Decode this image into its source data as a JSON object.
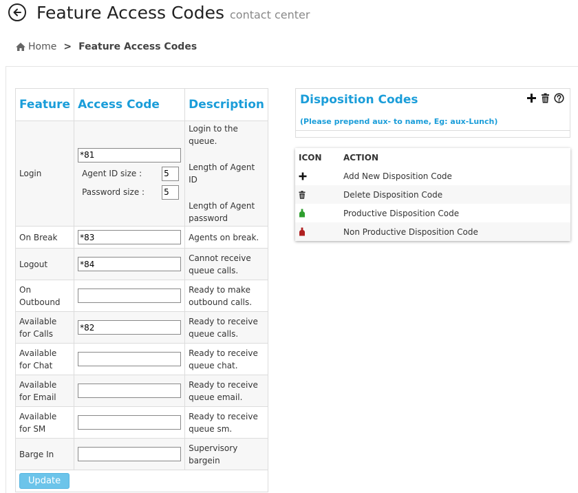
{
  "header": {
    "title": "Feature Access Codes",
    "subtitle": "contact center"
  },
  "breadcrumb": {
    "home": "Home",
    "separator": ">",
    "current": "Feature Access Codes"
  },
  "table": {
    "headers": {
      "feature": "Feature",
      "access_code": "Access Code",
      "description": "Description"
    },
    "login": {
      "feature": "Login",
      "code": "*81",
      "agent_id_label": "Agent ID size :",
      "agent_id_size": "5",
      "password_label": "Password size :",
      "password_size": "5",
      "desc1": "Login to the queue.",
      "desc2": "Length of Agent ID",
      "desc3": "Length of Agent password"
    },
    "rows": [
      {
        "feature": "On Break",
        "code": "*83",
        "description": "Agents on break."
      },
      {
        "feature": "Logout",
        "code": "*84",
        "description": "Cannot receive queue calls."
      },
      {
        "feature": "On Outbound",
        "code": "",
        "description": "Ready to make outbound calls."
      },
      {
        "feature": "Available for Calls",
        "code": "*82",
        "description": "Ready to receive queue calls."
      },
      {
        "feature": "Available for Chat",
        "code": "",
        "description": "Ready to receive queue chat."
      },
      {
        "feature": "Available for Email",
        "code": "",
        "description": "Ready to receive queue email."
      },
      {
        "feature": "Available for SM",
        "code": "",
        "description": "Ready to receive queue sm."
      },
      {
        "feature": "Barge In",
        "code": "",
        "description": "Supervisory bargein"
      }
    ],
    "update_label": "Update"
  },
  "disposition": {
    "title": "Disposition Codes",
    "note": "(Please prepend aux- to name, Eg: aux-Lunch)",
    "icons": [
      "plus-icon",
      "trash-icon",
      "help-icon"
    ]
  },
  "legend": {
    "icon_header": "ICON",
    "action_header": "ACTION",
    "items": [
      {
        "icon": "plus-icon",
        "action": "Add New Disposition Code"
      },
      {
        "icon": "trash-icon",
        "action": "Delete Disposition Code"
      },
      {
        "icon": "green-bottle-icon",
        "action": "Productive Disposition Code"
      },
      {
        "icon": "red-bottle-icon",
        "action": "Non Productive Disposition Code"
      }
    ]
  },
  "colors": {
    "accent": "#1a9dd9",
    "button": "#6cc4ea",
    "productive": "#2e9e2e",
    "non_productive": "#b02020"
  }
}
